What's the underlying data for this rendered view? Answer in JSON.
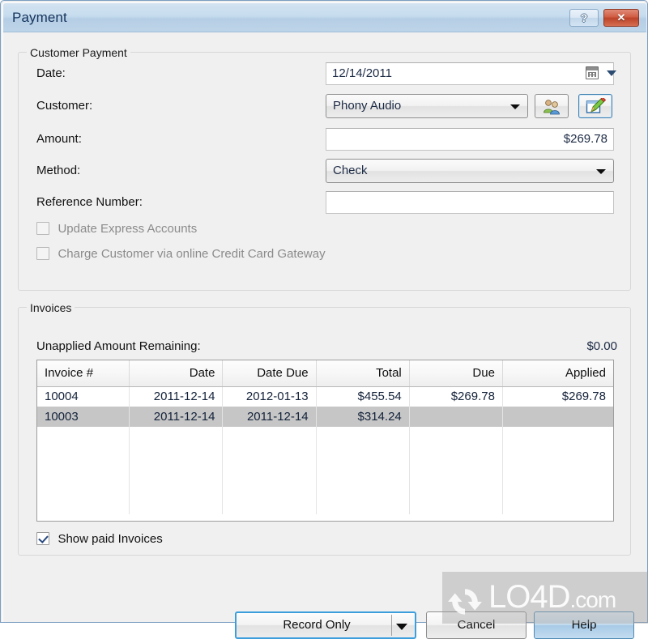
{
  "window": {
    "title": "Payment",
    "titlebar_buttons": [
      {
        "name": "help-title-button",
        "label": "?"
      },
      {
        "name": "close-button",
        "label": "✕"
      }
    ]
  },
  "customer_payment": {
    "group_title": "Customer Payment",
    "fields": {
      "date": {
        "label": "Date:",
        "value": "12/14/2011"
      },
      "customer": {
        "label": "Customer:",
        "value": "Phony Audio"
      },
      "amount": {
        "label": "Amount:",
        "value": "$269.78"
      },
      "method": {
        "label": "Method:",
        "value": "Check"
      },
      "reference_number": {
        "label": "Reference Number:",
        "value": ""
      }
    },
    "buttons": {
      "select_customer": "contacts-icon",
      "edit_customer": "edit-pencil-icon"
    },
    "checkboxes": [
      {
        "label": "Update Express Accounts",
        "checked": false,
        "disabled": true
      },
      {
        "label": "Charge Customer via online Credit Card Gateway",
        "checked": false,
        "disabled": true
      }
    ]
  },
  "invoices": {
    "group_title": "Invoices",
    "unapplied_label": "Unapplied Amount Remaining:",
    "unapplied_value": "$0.00",
    "columns": [
      "Invoice #",
      "Date",
      "Date Due",
      "Total",
      "Due",
      "Applied"
    ],
    "rows": [
      {
        "selected": false,
        "cells": [
          "10004",
          "2011-12-14",
          "2012-01-13",
          "$455.54",
          "$269.78",
          "$269.78"
        ]
      },
      {
        "selected": true,
        "cells": [
          "10003",
          "2011-12-14",
          "2011-12-14",
          "$314.24",
          "",
          ""
        ]
      }
    ],
    "show_paid": {
      "label": "Show paid Invoices",
      "checked": true
    }
  },
  "footer": {
    "record_only": "Record Only",
    "cancel": "Cancel",
    "help": "Help"
  },
  "watermark": {
    "text": "LO4D",
    "domain": ".com"
  },
  "colors": {
    "titlebar_top": "#d3e3f1",
    "titlebar_bottom": "#bdd4e8",
    "close_button": "#cf5c42",
    "focus_border": "#3c9fdc",
    "selected_row": "#c6c6c6",
    "dialog_background": "#f0f0f0",
    "text": "#111111",
    "disabled_text": "#8b8b8b"
  }
}
